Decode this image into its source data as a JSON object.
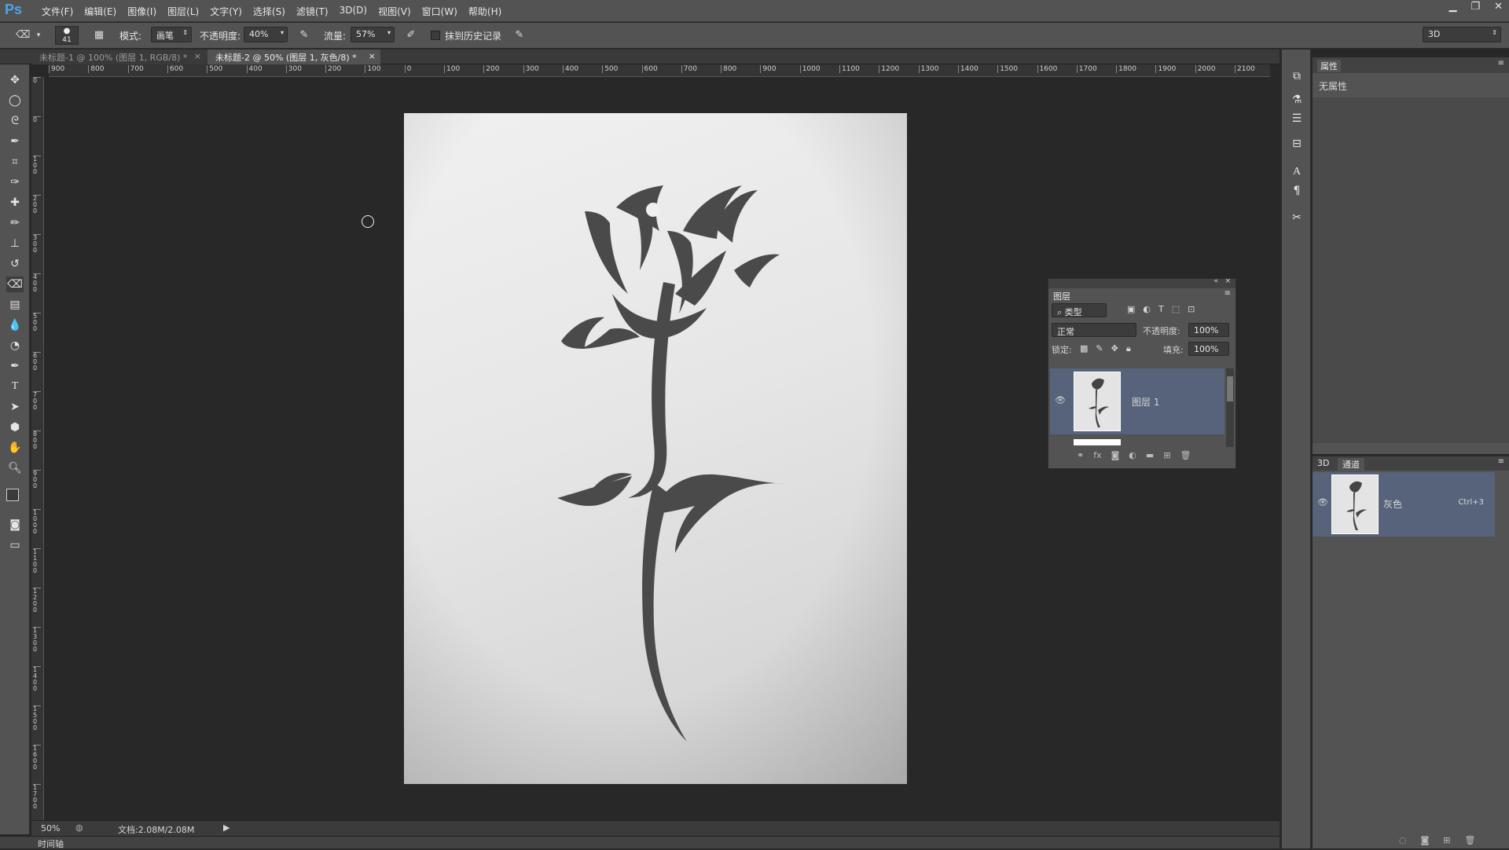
{
  "app": {
    "logo": "Ps"
  },
  "menu": [
    "文件(F)",
    "编辑(E)",
    "图像(I)",
    "图层(L)",
    "文字(Y)",
    "选择(S)",
    "滤镜(T)",
    "3D(D)",
    "视图(V)",
    "窗口(W)",
    "帮助(H)"
  ],
  "options": {
    "brush_size": "41",
    "mode_label": "模式:",
    "mode_value": "画笔",
    "opacity_label": "不透明度:",
    "opacity_value": "40%",
    "flow_label": "流量:",
    "flow_value": "57%",
    "history_label": "抹到历史记录",
    "workspace": "3D"
  },
  "tabs": [
    {
      "label": "未标题-1 @ 100% (图层 1, RGB/8) *",
      "active": false
    },
    {
      "label": "未标题-2 @ 50% (图层 1, 灰色/8) *",
      "active": true
    }
  ],
  "ruler_h": [
    "900",
    "800",
    "700",
    "600",
    "500",
    "400",
    "300",
    "200",
    "100",
    "0",
    "100",
    "200",
    "300",
    "400",
    "500",
    "600",
    "700",
    "800",
    "900",
    "1000",
    "1100",
    "1200",
    "1300",
    "1400",
    "1500",
    "1600",
    "1700",
    "1800",
    "1900",
    "2000",
    "2100"
  ],
  "ruler_v": [
    "0",
    "0",
    "100",
    "200",
    "300",
    "400",
    "500",
    "600",
    "700",
    "800",
    "900",
    "1000",
    "1100",
    "1200",
    "1300",
    "1400",
    "1500",
    "1600",
    "1700"
  ],
  "status": {
    "zoom": "50%",
    "doc": "文档:2.08M/2.08M"
  },
  "timeline_label": "时间轴",
  "layers_panel": {
    "title": "图层",
    "filter": "类型",
    "blend": "正常",
    "opacity_label": "不透明度:",
    "opacity_value": "100%",
    "lock_label": "锁定:",
    "fill_label": "填充:",
    "fill_value": "100%",
    "layer_name": "图层 1"
  },
  "properties_panel": {
    "title": "属性",
    "content": "无属性"
  },
  "channels_panel": {
    "tab_3d": "3D",
    "tab_channels": "通道",
    "channel_name": "灰色",
    "shortcut": "Ctrl+3"
  },
  "colors": {
    "accent": "#4fa3e8",
    "selected_row": "#56637a",
    "ui_bg": "#535353",
    "canvas_bg": "#282828"
  }
}
